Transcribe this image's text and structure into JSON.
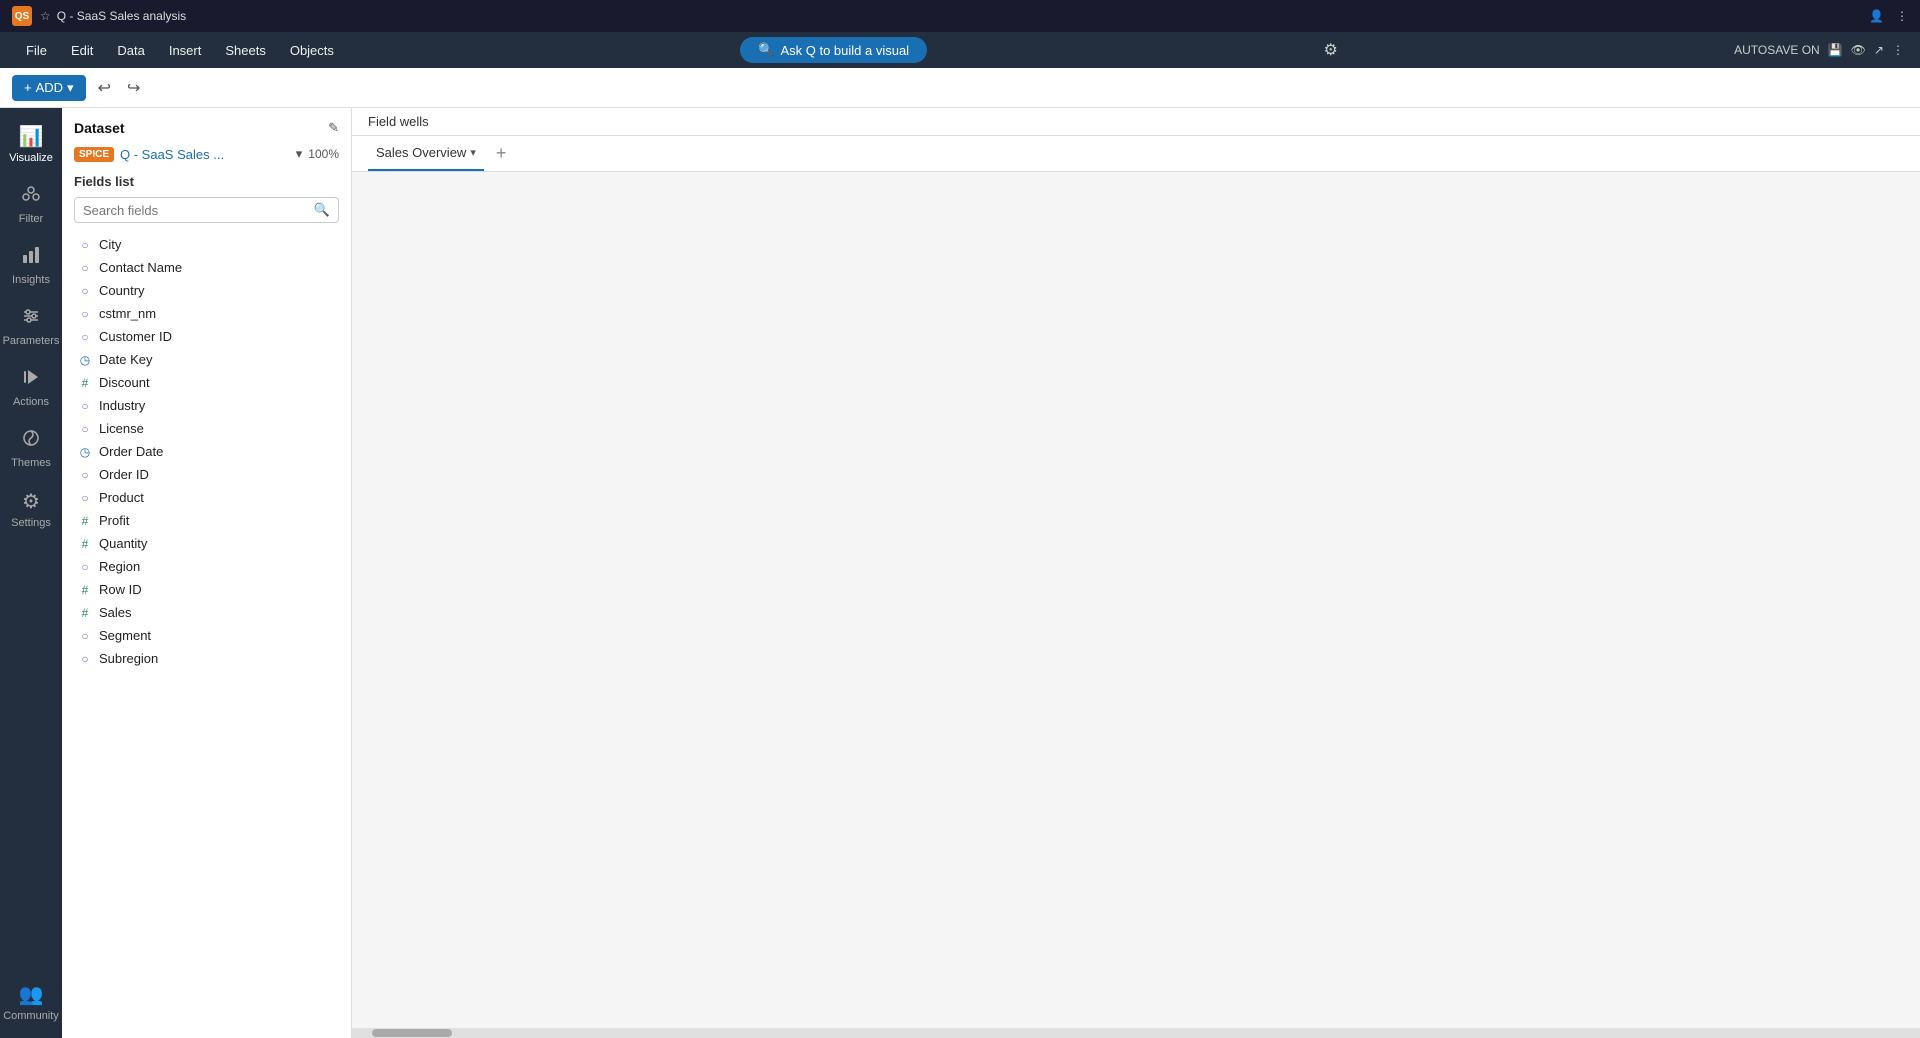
{
  "titlebar": {
    "logo": "QS",
    "tab": "Q - SaaS Sales analysis",
    "star": "☆"
  },
  "menubar": {
    "items": [
      "File",
      "Edit",
      "Data",
      "Insert",
      "Sheets",
      "Objects"
    ],
    "ask_q_label": "Ask Q to build a visual",
    "autosave": "AUTOSAVE ON"
  },
  "toolbar": {
    "add_label": "ADD",
    "undo": "↩",
    "redo": "↪"
  },
  "nav": {
    "items": [
      {
        "id": "visualize",
        "label": "Visualize",
        "icon": "📊",
        "active": true
      },
      {
        "id": "filter",
        "label": "Filter",
        "icon": "🔽"
      },
      {
        "id": "insights",
        "label": "Insights",
        "icon": "💡"
      },
      {
        "id": "parameters",
        "label": "Parameters",
        "icon": "⚙️"
      },
      {
        "id": "actions",
        "label": "Actions",
        "icon": "⚡"
      },
      {
        "id": "themes",
        "label": "Themes",
        "icon": "🎨"
      },
      {
        "id": "settings",
        "label": "Settings",
        "icon": "⚙️"
      },
      {
        "id": "community",
        "label": "Community",
        "icon": "👥"
      }
    ]
  },
  "panel": {
    "dataset_label": "Dataset",
    "spice_badge": "SPICE",
    "dataset_name": "Q - SaaS Sales ...",
    "dataset_percent": "100%",
    "fields_list_label": "Fields list",
    "search_placeholder": "Search fields",
    "fields": [
      {
        "name": "City",
        "type": "dim"
      },
      {
        "name": "Contact Name",
        "type": "dim"
      },
      {
        "name": "Country",
        "type": "dim"
      },
      {
        "name": "cstmr_nm",
        "type": "dim"
      },
      {
        "name": "Customer ID",
        "type": "dim"
      },
      {
        "name": "Date Key",
        "type": "date"
      },
      {
        "name": "Discount",
        "type": "measure"
      },
      {
        "name": "Industry",
        "type": "dim"
      },
      {
        "name": "License",
        "type": "dim"
      },
      {
        "name": "Order Date",
        "type": "date"
      },
      {
        "name": "Order ID",
        "type": "dim"
      },
      {
        "name": "Product",
        "type": "dim"
      },
      {
        "name": "Profit",
        "type": "measure"
      },
      {
        "name": "Quantity",
        "type": "measure"
      },
      {
        "name": "Region",
        "type": "dim"
      },
      {
        "name": "Row ID",
        "type": "measure"
      },
      {
        "name": "Sales",
        "type": "measure"
      },
      {
        "name": "Segment",
        "type": "dim"
      },
      {
        "name": "Subregion",
        "type": "dim"
      }
    ]
  },
  "content": {
    "field_wells_label": "Field wells",
    "sheet_tab_label": "Sales Overview",
    "add_tab": "+"
  }
}
